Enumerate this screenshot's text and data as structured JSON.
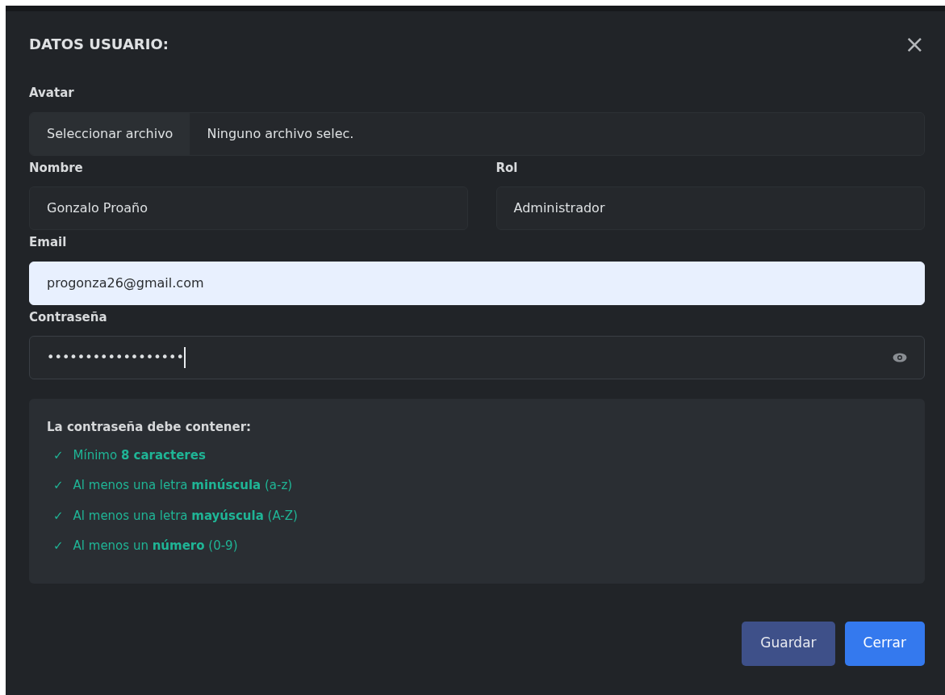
{
  "dialog": {
    "title": "DATOS USUARIO:",
    "close": "×"
  },
  "avatar": {
    "label": "Avatar",
    "button": "Seleccionar archivo",
    "file_name": "Ninguno archivo selec."
  },
  "name": {
    "label": "Nombre",
    "value": "Gonzalo Proaño"
  },
  "role": {
    "label": "Rol",
    "value": "Administrador"
  },
  "email": {
    "label": "Email",
    "value": "progonza26@gmail.com",
    "autofilled": true
  },
  "password": {
    "label": "Contraseña",
    "masked_value": "••••••••••••••••••",
    "focused": true
  },
  "requirements": {
    "title": "La contraseña debe contener:",
    "items": [
      {
        "mark": "✓",
        "text": "Mínimo **8 caracteres**",
        "met": true
      },
      {
        "mark": "✓",
        "text": "Al menos una letra **minúscula** (a-z)",
        "met": true
      },
      {
        "mark": "✓",
        "text": "Al menos una letra **mayúscula** (A-Z)",
        "met": true
      },
      {
        "mark": "✓",
        "text": "Al menos un **número** (0-9)",
        "met": true
      }
    ]
  },
  "buttons": [
    {
      "label": "Guardar",
      "kind": "save"
    },
    {
      "label": "Cerrar",
      "kind": "close"
    }
  ]
}
